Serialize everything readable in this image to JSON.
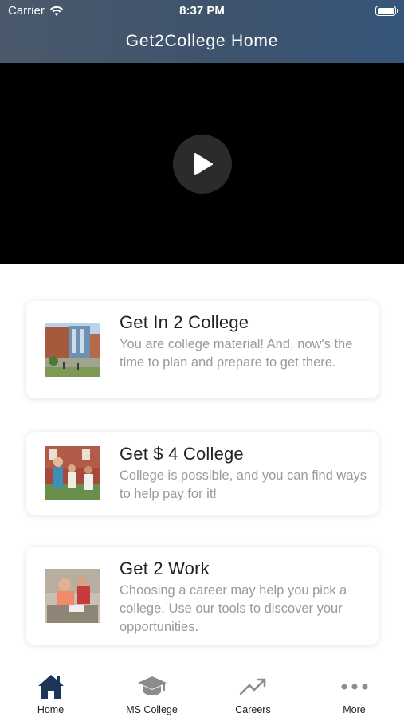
{
  "status_bar": {
    "carrier": "Carrier",
    "time": "8:37 PM"
  },
  "header": {
    "title": "Get2College Home"
  },
  "video": {
    "play_icon": "play-icon"
  },
  "cards": [
    {
      "title": "Get In 2 College",
      "description": "You are college material! And, now's the time to plan and prepare to get there.",
      "image": "campus-photo"
    },
    {
      "title": "Get $ 4 College",
      "description": "College is possible, and you can find ways to help pay for it!",
      "image": "students-photo"
    },
    {
      "title": "Get 2 Work",
      "description": "Choosing a career may help you pick a college. Use our tools to discover your opportunities.",
      "image": "career-photo"
    }
  ],
  "tabbar": {
    "tabs": [
      {
        "label": "Home",
        "icon": "home-icon",
        "active": true
      },
      {
        "label": "MS College",
        "icon": "graduation-cap-icon",
        "active": false
      },
      {
        "label": "Careers",
        "icon": "trending-up-icon",
        "active": false
      },
      {
        "label": "More",
        "icon": "more-dots-icon",
        "active": false
      }
    ]
  },
  "colors": {
    "header_start": "#4a5a6c",
    "header_end": "#36557a",
    "active_tab": "#1d3557",
    "inactive_tab": "#8c8c8c",
    "desc_text": "#9a9a9a"
  }
}
